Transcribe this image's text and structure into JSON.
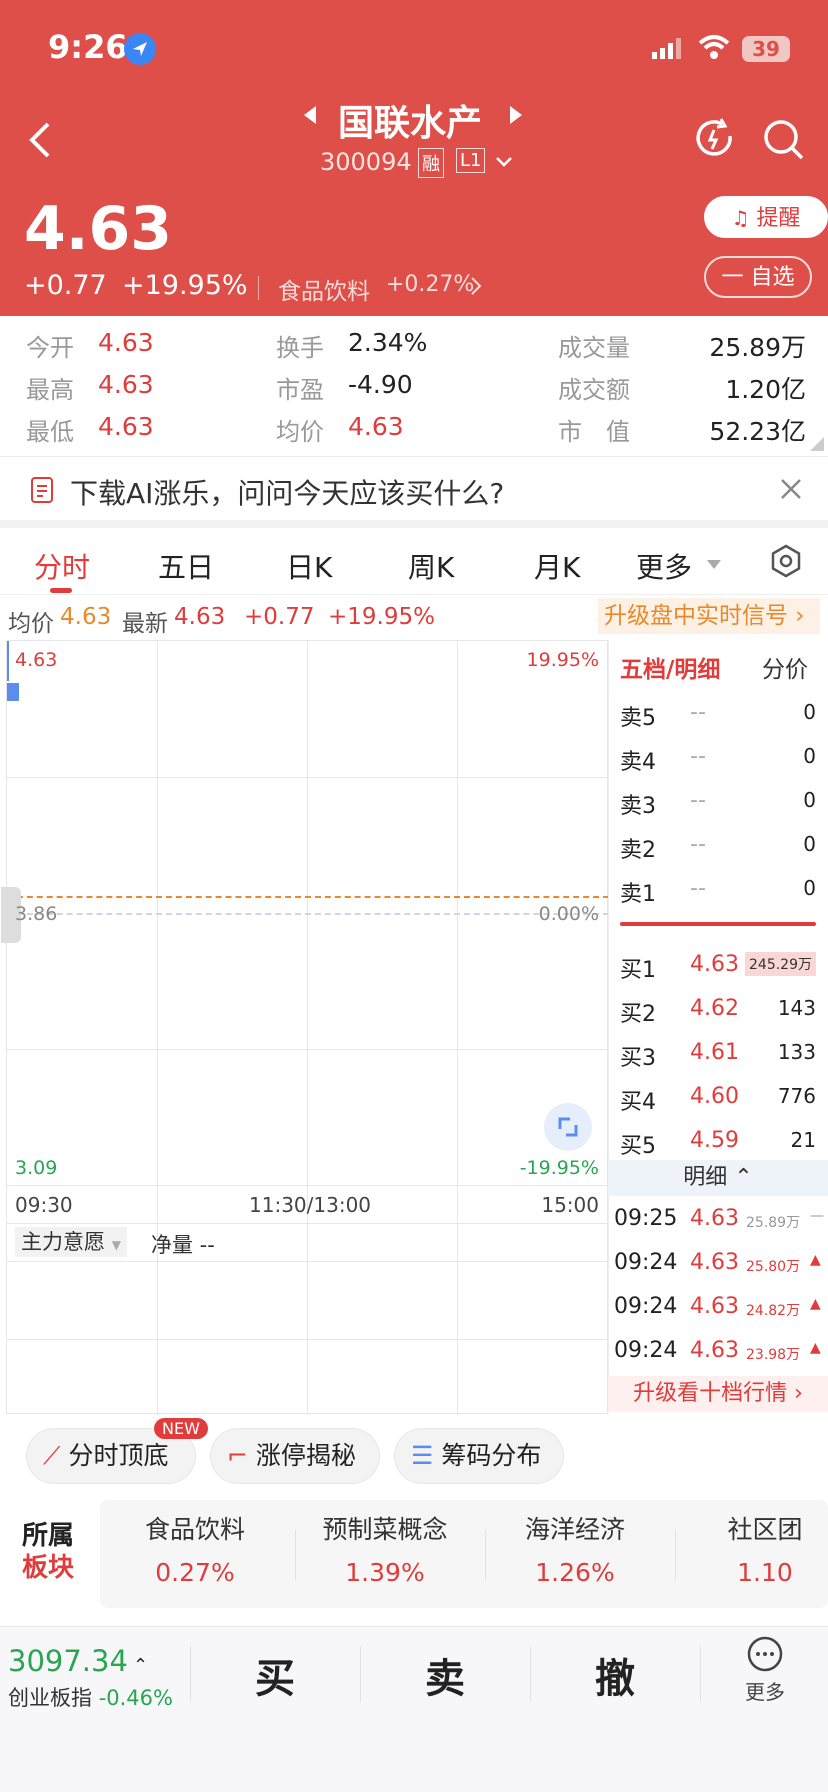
{
  "status": {
    "time": "9:26",
    "battery": "39"
  },
  "header": {
    "title": "国联水产",
    "code": "300094",
    "badge_rong": "融",
    "badge_l1": "L1",
    "price": "4.63",
    "change": "+0.77",
    "change_pct": "+19.95%",
    "sector": "食品饮料",
    "sector_pct": "+0.27%",
    "alert_label": "提醒",
    "watch_label": "一 自选"
  },
  "stats": [
    {
      "label": "今开",
      "value": "4.63"
    },
    {
      "label": "最高",
      "value": "4.63"
    },
    {
      "label": "最低",
      "value": "4.63"
    },
    {
      "label": "换手",
      "value": "2.34%"
    },
    {
      "label": "市盈",
      "value": "-4.90"
    },
    {
      "label": "均价",
      "value": "4.63"
    },
    {
      "label": "成交量",
      "value": "25.89万"
    },
    {
      "label": "成交额",
      "value": "1.20亿"
    },
    {
      "label": "市　值",
      "value": "52.23亿"
    }
  ],
  "ad": {
    "text": "下载AI涨乐，问问今天应该买什么?"
  },
  "tabs": [
    "分时",
    "五日",
    "日K",
    "周K",
    "月K",
    "更多"
  ],
  "infobar": {
    "avg_label": "均价",
    "avg_value": "4.63",
    "latest_label": "最新",
    "latest_value": "4.63",
    "change": "+0.77",
    "change_pct": "+19.95%",
    "upgrade": "升级盘中实时信号"
  },
  "chart": {
    "top_price": "4.63",
    "top_pct": "19.95%",
    "mid_price": "3.86",
    "mid_pct": "0.00%",
    "bottom_price": "3.09",
    "bottom_pct": "-19.95%",
    "times": [
      "09:30",
      "11:30/13:00",
      "15:00"
    ],
    "sub_label": "主力意愿",
    "net_label": "净量 --"
  },
  "orderbook": {
    "header_left": "五档/明细",
    "header_right": "分价",
    "sells": [
      {
        "name": "卖5",
        "price": "--",
        "vol": "0"
      },
      {
        "name": "卖4",
        "price": "--",
        "vol": "0"
      },
      {
        "name": "卖3",
        "price": "--",
        "vol": "0"
      },
      {
        "name": "卖2",
        "price": "--",
        "vol": "0"
      },
      {
        "name": "卖1",
        "price": "--",
        "vol": "0"
      }
    ],
    "buys": [
      {
        "name": "买1",
        "price": "4.63",
        "vol": "245.29万"
      },
      {
        "name": "买2",
        "price": "4.62",
        "vol": "143"
      },
      {
        "name": "买3",
        "price": "4.61",
        "vol": "133"
      },
      {
        "name": "买4",
        "price": "4.60",
        "vol": "776"
      },
      {
        "name": "买5",
        "price": "4.59",
        "vol": "21"
      }
    ],
    "detail_label": "明细",
    "details": [
      {
        "time": "09:25",
        "price": "4.63",
        "vol": "25.89万"
      },
      {
        "time": "09:24",
        "price": "4.63",
        "vol": "25.80万"
      },
      {
        "time": "09:24",
        "price": "4.63",
        "vol": "24.82万"
      },
      {
        "time": "09:24",
        "price": "4.63",
        "vol": "23.98万"
      }
    ],
    "upgrade": "升级看十档行情"
  },
  "chips": [
    {
      "label": "分时顶底",
      "badge": "NEW"
    },
    {
      "label": "涨停揭秘"
    },
    {
      "label": "筹码分布"
    }
  ],
  "sectors": {
    "title1": "所属",
    "title2": "板块",
    "items": [
      {
        "name": "食品饮料",
        "pct": "0.27%"
      },
      {
        "name": "预制菜概念",
        "pct": "1.39%"
      },
      {
        "name": "海洋经济",
        "pct": "1.26%"
      },
      {
        "name": "社区团",
        "pct": "1.10"
      }
    ]
  },
  "bottom": {
    "index_value": "3097.34",
    "index_name": "创业板指",
    "index_pct": "-0.46%",
    "buy": "买",
    "sell": "卖",
    "cancel": "撤",
    "more": "更多"
  }
}
